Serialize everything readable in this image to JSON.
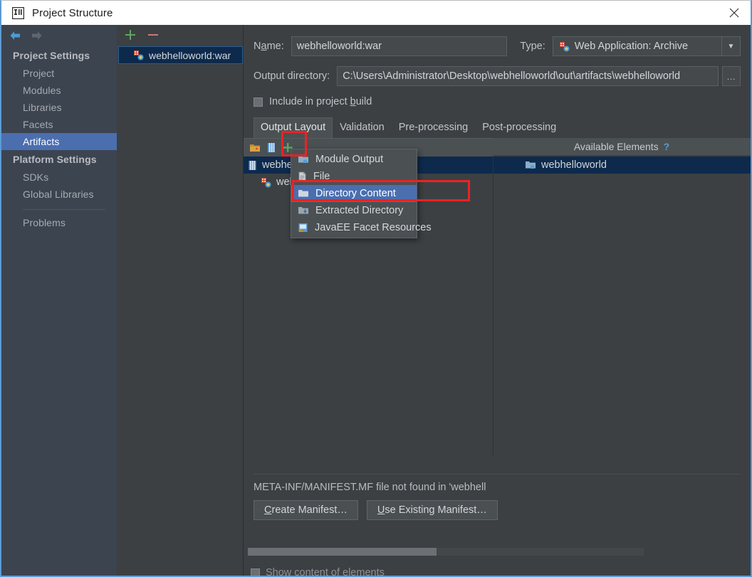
{
  "window": {
    "title": "Project Structure",
    "app_icon": "intellij-idea-icon",
    "close_label": "✕"
  },
  "nav": {
    "back_icon": "arrow-left-icon",
    "forward_icon": "arrow-right-icon"
  },
  "sidebar": {
    "groups": [
      {
        "label": "Project Settings",
        "items": [
          {
            "label": "Project",
            "selected": false
          },
          {
            "label": "Modules",
            "selected": false
          },
          {
            "label": "Libraries",
            "selected": false
          },
          {
            "label": "Facets",
            "selected": false
          },
          {
            "label": "Artifacts",
            "selected": true
          }
        ]
      },
      {
        "label": "Platform Settings",
        "items": [
          {
            "label": "SDKs",
            "selected": false
          },
          {
            "label": "Global Libraries",
            "selected": false
          }
        ]
      }
    ],
    "problems": {
      "label": "Problems"
    }
  },
  "artifacts_list": {
    "add_button": "add-artifact-button",
    "remove_button": "remove-artifact-button",
    "items": [
      {
        "label": "webhelloworld:war",
        "icon": "war-artifact-icon",
        "selected": true
      }
    ]
  },
  "details": {
    "name_label": "Name:",
    "name_mnemonic": "a",
    "name_value": "webhelloworld:war",
    "type_label": "Type:",
    "type_value": "Web Application: Archive",
    "type_icon": "war-artifact-icon",
    "type_arrow": "▼",
    "output_dir_label": "Output directory:",
    "output_dir_value": "C:\\Users\\Administrator\\Desktop\\webhelloworld\\out\\artifacts\\webhelloworld",
    "browse_label": "…",
    "include_checkbox": {
      "label_before": "Include in project ",
      "mnemonic": "b",
      "label_after": "uild",
      "checked": false
    }
  },
  "tabs": [
    {
      "label": "Output Layout",
      "active": true
    },
    {
      "label": "Validation",
      "active": false
    },
    {
      "label": "Pre-processing",
      "active": false
    },
    {
      "label": "Post-processing",
      "active": false
    }
  ],
  "tree_toolbar": {
    "create_dir_icon": "new-directory-icon",
    "create_archive_icon": "new-archive-icon",
    "add_icon": "add-element-icon",
    "add_dropdown_arrow": "▾"
  },
  "available_elements": {
    "header": "Available Elements",
    "help_icon": "?",
    "items": [
      {
        "label": "webhelloworld",
        "icon": "module-icon",
        "selected": true
      }
    ]
  },
  "output_tree": {
    "nodes": [
      {
        "label": "webhell",
        "icon": "archive-icon",
        "indent": 0,
        "selected": true
      },
      {
        "label": "webh",
        "icon": "war-artifact-icon",
        "indent": 1,
        "selected": false
      }
    ]
  },
  "add_menu": {
    "items": [
      {
        "label": "Module Output",
        "icon": "module-output-icon",
        "highlighted": false
      },
      {
        "label": "File",
        "icon": "file-icon",
        "highlighted": false
      },
      {
        "label": "Directory Content",
        "icon": "directory-icon",
        "highlighted": true
      },
      {
        "label": "Extracted Directory",
        "icon": "extracted-directory-icon",
        "highlighted": false
      },
      {
        "label": "JavaEE Facet Resources",
        "icon": "javaee-facet-icon",
        "highlighted": false
      }
    ]
  },
  "manifest": {
    "message": "META-INF/MANIFEST.MF file not found in 'webhell",
    "create_button": {
      "mnemonic": "C",
      "rest": "reate Manifest…"
    },
    "use_existing_button": {
      "mnemonic": "U",
      "rest": "se Existing Manifest…"
    }
  },
  "bottom": {
    "cut_off_label": "Show content of elements"
  },
  "colors": {
    "accent_selection": "#4b6eaf",
    "tree_selection": "#0d2a4d",
    "annotation_red": "#ee2222",
    "window_bg": "#3c4043",
    "sidebar_bg": "#3c4450",
    "panel_bg": "#4b5053",
    "help_blue": "#5b9bd5",
    "add_green": "#5fa55f",
    "remove_red": "#c87a7a"
  }
}
